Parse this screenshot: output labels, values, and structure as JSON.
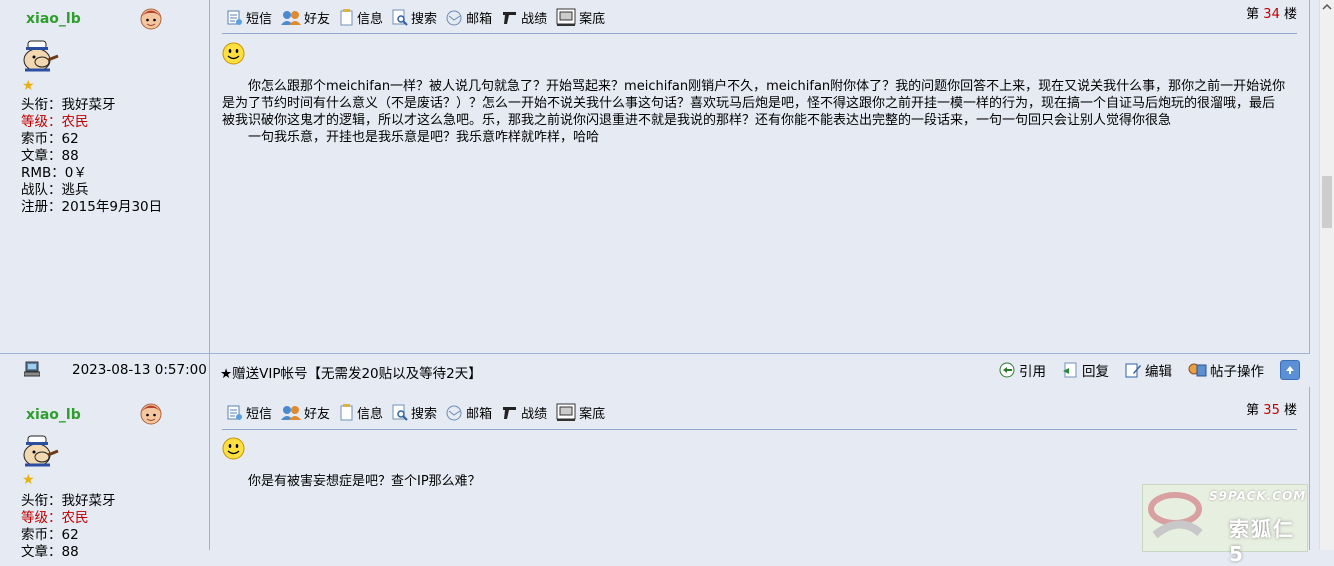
{
  "posts": [
    {
      "username": "xiao_lb",
      "info": {
        "title_label": "头衔：",
        "title_value": "我好菜牙",
        "level_label": "等级：",
        "level_value": "农民",
        "coins_label": "索币：",
        "coins_value": "62",
        "articles_label": "文章：",
        "articles_value": "88",
        "rmb_label": "RMB：",
        "rmb_value": "0￥",
        "team_label": "战队：",
        "team_value": "逃兵",
        "reg_label": "注册：",
        "reg_value": "2015年9月30日"
      },
      "toolbar": [
        "短信",
        "好友",
        "信息",
        "搜索",
        "邮箱",
        "战绩",
        "案底"
      ],
      "floor": {
        "prefix": "第",
        "number": "34",
        "suffix": "楼"
      },
      "message": [
        "你怎么跟那个meichifan一样？被人说几句就急了？开始骂起来？meichifan刚销户不久，meichifan附你体了？我的问题你回答不上来，现在又说关我什么事，那你之前一开始说你是为了节约时间有什么意义（不是废话？）？怎么一开始不说关我什么事这句话？喜欢玩马后炮是吧，怪不得这跟你之前开挂一模一样的行为，现在搞一个自证马后炮玩的很溜哦，最后被我识破你这鬼才的逻辑，所以才这么急吧。乐，那我之前说你闪退重进不就是我说的那样？还有你能不能表达出完整的一段话来，一句一句回只会让别人觉得你很急",
        "一句我乐意，开挂也是我乐意是吧？我乐意咋样就咋样，哈哈"
      ]
    },
    {
      "username": "xiao_lb",
      "info": {
        "title_label": "头衔：",
        "title_value": "我好菜牙",
        "level_label": "等级：",
        "level_value": "农民",
        "coins_label": "索币：",
        "coins_value": "62",
        "articles_label": "文章：",
        "articles_value": "88"
      },
      "toolbar": [
        "短信",
        "好友",
        "信息",
        "搜索",
        "邮箱",
        "战绩",
        "案底"
      ],
      "floor": {
        "prefix": "第",
        "number": "35",
        "suffix": "楼"
      },
      "message": [
        "你是有被害妄想症是吧？查个IP那么难？"
      ]
    }
  ],
  "footer": {
    "timestamp": "2023-08-13 0:57:00",
    "note": "★赠送VIP帐号【无需发20贴以及等待2天】",
    "actions": [
      "引用",
      "回复",
      "编辑",
      "帖子操作"
    ]
  },
  "watermark": {
    "text": "S9PACK.COM",
    "cn": "索狐仁5"
  },
  "colors": {
    "background": "#e6ebf3",
    "border": "#9fb3d4",
    "username": "#2e9e2e",
    "accent_red": "#c00000"
  }
}
